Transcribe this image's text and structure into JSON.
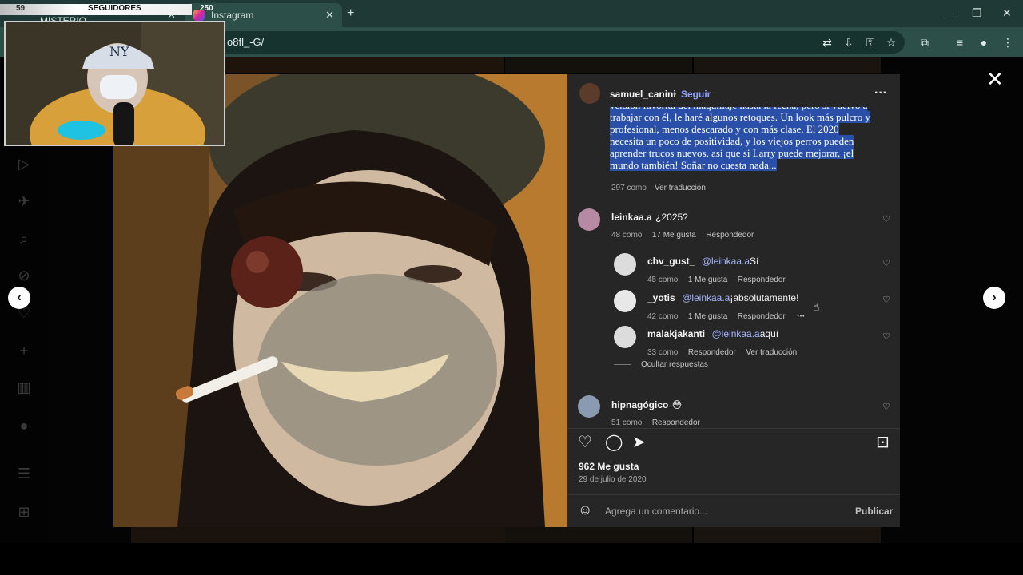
{
  "browser": {
    "tab1_title": "Qué pasó con este MISTERIO",
    "tab2_title": "Instagram",
    "url": "o8fl_-G/",
    "newtab_symbol": "+",
    "min_symbol": "—",
    "max_symbol": "❐",
    "close_symbol": "✕"
  },
  "overlay": {
    "followers_label": "SEGUIDORES",
    "followers_count": "250",
    "left_count": "59"
  },
  "post": {
    "author": "samuel_canini",
    "follow": "Seguir",
    "more": "···",
    "caption": "versión favorita del maquillaje hasta la fecha, pero si vuelvo a trabajar con él, le haré algunos retoques. Un look más pulcro y profesional, menos descarado y con más clase. El 2020 necesita un poco de positividad, y los viejos perros pueden aprender trucos nuevos, así que si Larry puede mejorar, ¡el mundo también! Soñar no cuesta nada...",
    "caption_likes": "297 como",
    "caption_translate": "Ver traducción",
    "likes": "962 Me gusta",
    "date": "29 de julio de 2020",
    "comment_placeholder": "Agrega un comentario...",
    "publish": "Publicar"
  },
  "comments": [
    {
      "user": "leinkaa.a",
      "text": "¿2025?",
      "likes": "48 como",
      "gusta": "17 Me gusta",
      "reply": "Respondedor"
    },
    {
      "user": "hipnagógico",
      "text": "😳",
      "likes": "51 como",
      "reply": "Respondedor"
    }
  ],
  "replies": [
    {
      "user": "chv_gust_",
      "mention": "@leinkaa.a",
      "text": "Sí",
      "likes": "45 como",
      "gusta": "1 Me gusta",
      "reply": "Respondedor"
    },
    {
      "user": "_yotis",
      "mention": "@leinkaa.a",
      "text": "¡absolutamente!",
      "likes": "42 como",
      "gusta": "1 Me gusta",
      "reply": "Respondedor",
      "more": "···"
    },
    {
      "user": "malakjakanti",
      "mention": "@leinkaa.a",
      "text": "aquí",
      "likes": "33 como",
      "reply": "Respondedor",
      "translate": "Ver traducción"
    }
  ],
  "hide_replies": "Ocultar respuestas",
  "icons": {
    "heart": "♡",
    "close": "✕",
    "prev": "‹",
    "next": "›",
    "like": "♡",
    "comment": "◯",
    "share": "➤",
    "save": "⊡",
    "emoji": "☺"
  },
  "colors": {
    "panel_bg": "#262626",
    "accent_link": "#a5b4ff",
    "caption_highlight": "#2a4fa8",
    "chrome_bg": "#1f3a36"
  }
}
